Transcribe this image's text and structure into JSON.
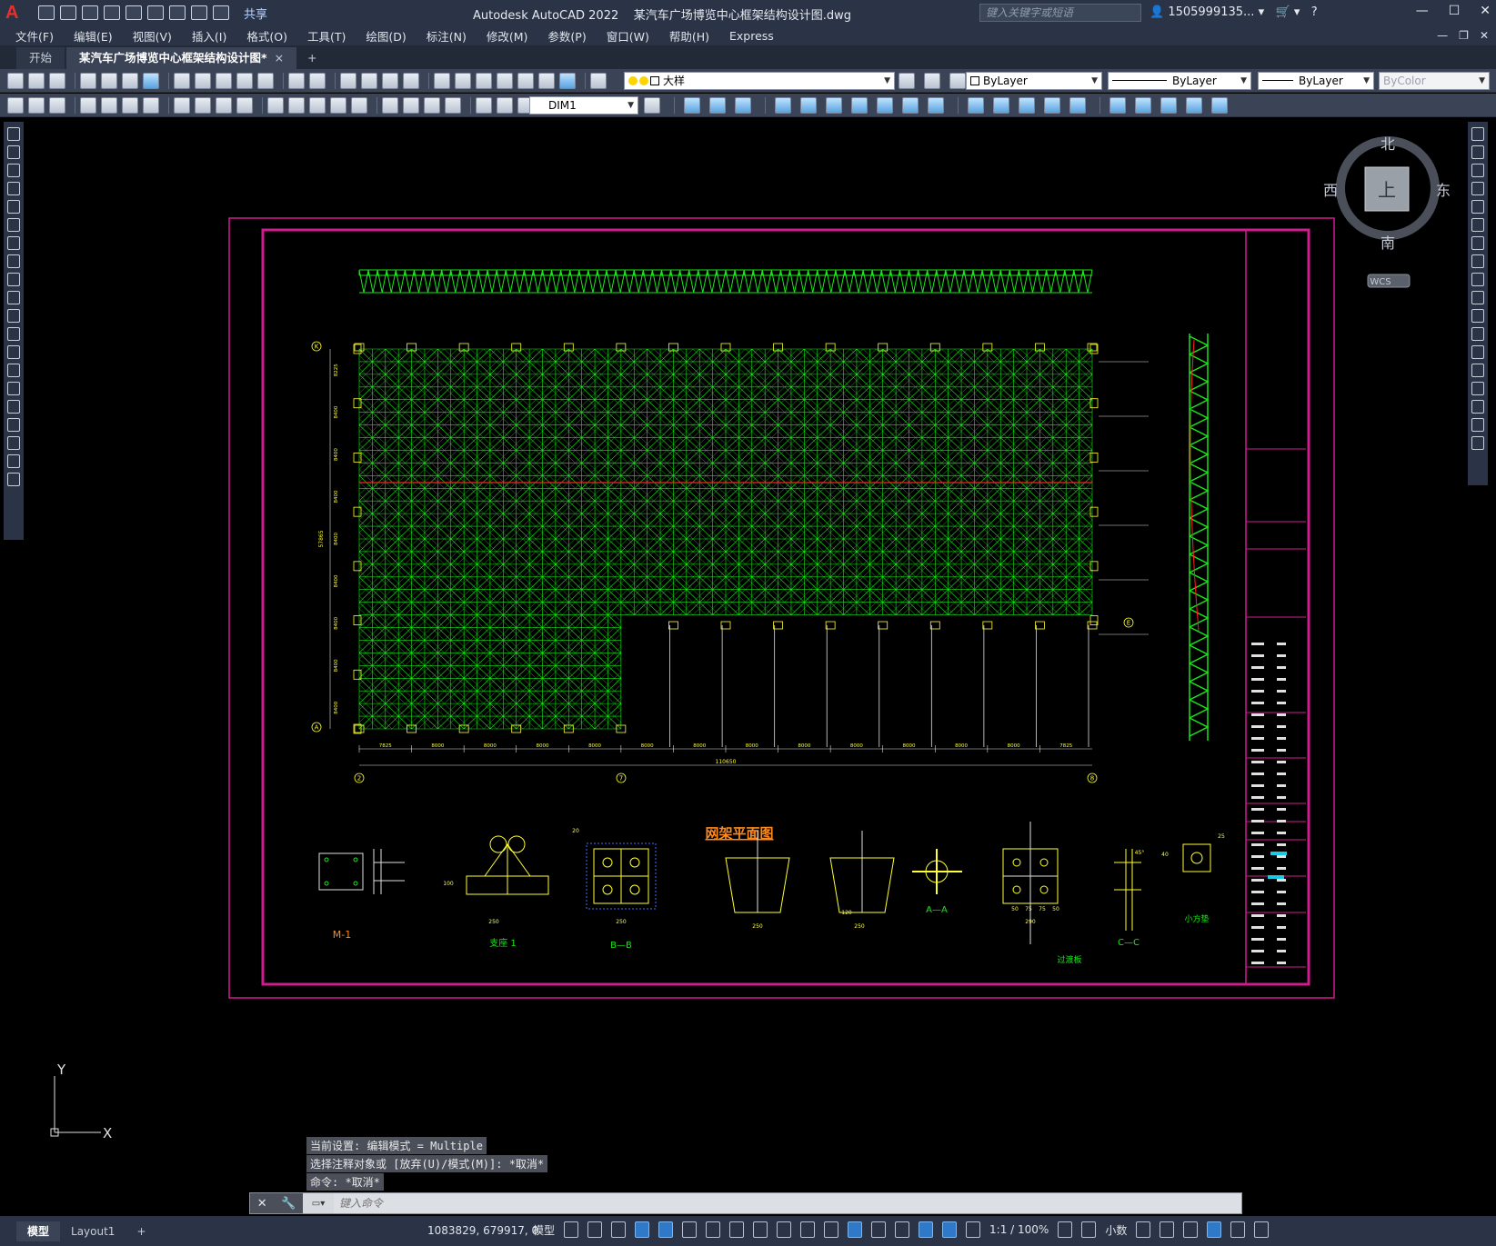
{
  "title_bar": {
    "app_name": "Autodesk AutoCAD 2022",
    "file_name": "某汽车广场博览中心框架结构设计图.dwg",
    "share_label": "共享",
    "search_placeholder": "键入关键字或短语",
    "account": "1505999135...",
    "app_logo_letter": "A"
  },
  "menu": [
    "文件(F)",
    "编辑(E)",
    "视图(V)",
    "插入(I)",
    "格式(O)",
    "工具(T)",
    "绘图(D)",
    "标注(N)",
    "修改(M)",
    "参数(P)",
    "窗口(W)",
    "帮助(H)",
    "Express"
  ],
  "tabs": {
    "start": "开始",
    "active": "某汽车广场博览中心框架结构设计图*",
    "close": "×",
    "new": "+"
  },
  "properties": {
    "layer": "大样",
    "color": "ByLayer",
    "linetype": "ByLayer",
    "lineweight": "ByLayer",
    "plotstyle": "ByColor",
    "dimstyle": "DIM1"
  },
  "viewcube": {
    "north": "北",
    "south": "南",
    "west": "西",
    "east": "东",
    "top_face": "上",
    "wcs": "WCS"
  },
  "drawing": {
    "plan_title": "网架平面图",
    "axis_top_left": "K",
    "axis_bottom_left": "A",
    "axis_right": "E",
    "axis_bottom_1": "2",
    "axis_bottom_2": "7",
    "axis_bottom_3": "8",
    "total_dim": "110650",
    "bottom_dims": [
      "7825",
      "8000",
      "8000",
      "8000",
      "8000",
      "8000",
      "8000",
      "8000",
      "8000",
      "8000",
      "8000",
      "8000",
      "8000",
      "7825"
    ],
    "left_dims": [
      "8225",
      "8400",
      "8400",
      "8400",
      "8400",
      "8400",
      "8400",
      "8400",
      "8400"
    ],
    "left_total": "57865",
    "detail_labels": {
      "m1": "M-1",
      "support": "支座 1",
      "bb": "B—B",
      "aa": "A—A",
      "plate": "过渡板",
      "cc": "C—C",
      "small_box": "小方垫"
    },
    "detail_dims": [
      "250",
      "250",
      "250",
      "250",
      "290",
      "120",
      "100",
      "40",
      "20",
      "45°",
      "25",
      "50",
      "75",
      "75",
      "50"
    ]
  },
  "axes_icon": {
    "x": "X",
    "y": "Y"
  },
  "command": {
    "history": [
      "当前设置: 编辑模式 = Multiple",
      "选择注释对象或 [放弃(U)/模式(M)]: *取消*",
      "命令: *取消*"
    ],
    "input_placeholder": "键入命令"
  },
  "status": {
    "layout_tabs": [
      "模型",
      "Layout1"
    ],
    "add_layout": "+",
    "coordinates": "1083829, 679917, 0",
    "model_label": "模型",
    "scale": "1:1 / 100%",
    "units": "小数"
  },
  "colors": {
    "frame_magenta": "#d01b8f",
    "truss_green": "#19e619",
    "annotation_yellow": "#ffff33",
    "annotation_white": "#e0e0e0",
    "red_line": "#ff2020",
    "accent_blue": "#2e79c8"
  }
}
